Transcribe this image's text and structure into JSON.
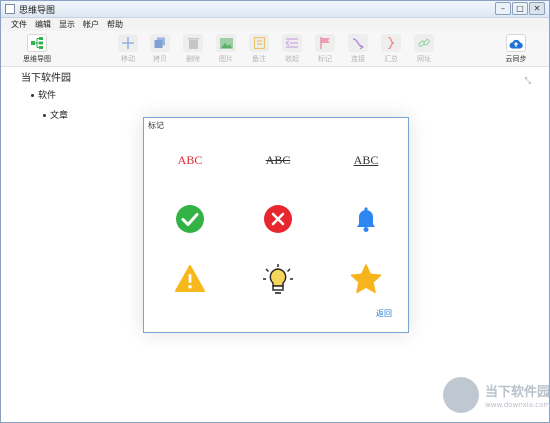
{
  "window": {
    "title": "思维导图"
  },
  "menubar": {
    "items": [
      "文件",
      "编辑",
      "显示",
      "帐户",
      "帮助"
    ]
  },
  "toolbar": {
    "tools": [
      {
        "label": "思维导图",
        "icon": "mindmap-icon",
        "active": true
      },
      {
        "label": "移动",
        "icon": "move-icon"
      },
      {
        "label": "拷贝",
        "icon": "copy-icon"
      },
      {
        "label": "删除",
        "icon": "trash-icon"
      },
      {
        "label": "图片",
        "icon": "image-icon"
      },
      {
        "label": "备注",
        "icon": "note-icon"
      },
      {
        "label": "收起",
        "icon": "collapse-icon"
      },
      {
        "label": "标记",
        "icon": "flag-icon"
      },
      {
        "label": "连接",
        "icon": "connect-icon"
      },
      {
        "label": "汇总",
        "icon": "summary-icon"
      },
      {
        "label": "网址",
        "icon": "link-icon"
      },
      {
        "label": "云同步",
        "icon": "cloud-upload-icon",
        "active": true
      }
    ]
  },
  "tree": {
    "root": "当下软件园",
    "child": "软件",
    "grandchild": "文章"
  },
  "dialog": {
    "title": "标记",
    "abc_red": "ABC",
    "abc_strike": "ABC",
    "abc_underline": "ABC",
    "back": "返回"
  },
  "watermark": {
    "name": "当下软件园",
    "url": "www.downxia.com"
  }
}
